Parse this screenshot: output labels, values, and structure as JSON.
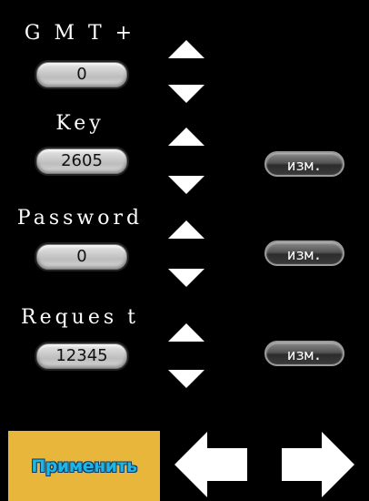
{
  "groups": [
    {
      "label": "G M T +",
      "value": "0",
      "edit_label": ""
    },
    {
      "label": "Key",
      "value": "2605",
      "edit_label": "изм."
    },
    {
      "label": "Password",
      "value": "0",
      "edit_label": "изм."
    },
    {
      "label": "Reques t",
      "value": "12345",
      "edit_label": "изм."
    }
  ],
  "apply_label": "Применить",
  "colors": {
    "background": "#000000",
    "apply_bg": "#e8b63a",
    "apply_text": "#1fb6e6",
    "pill": "#cfcfcf",
    "edit_button": "#4a4a4a"
  },
  "icons": {
    "increment": "triangle-up-icon",
    "decrement": "triangle-down-icon",
    "back": "arrow-left-icon",
    "forward": "arrow-right-icon"
  }
}
